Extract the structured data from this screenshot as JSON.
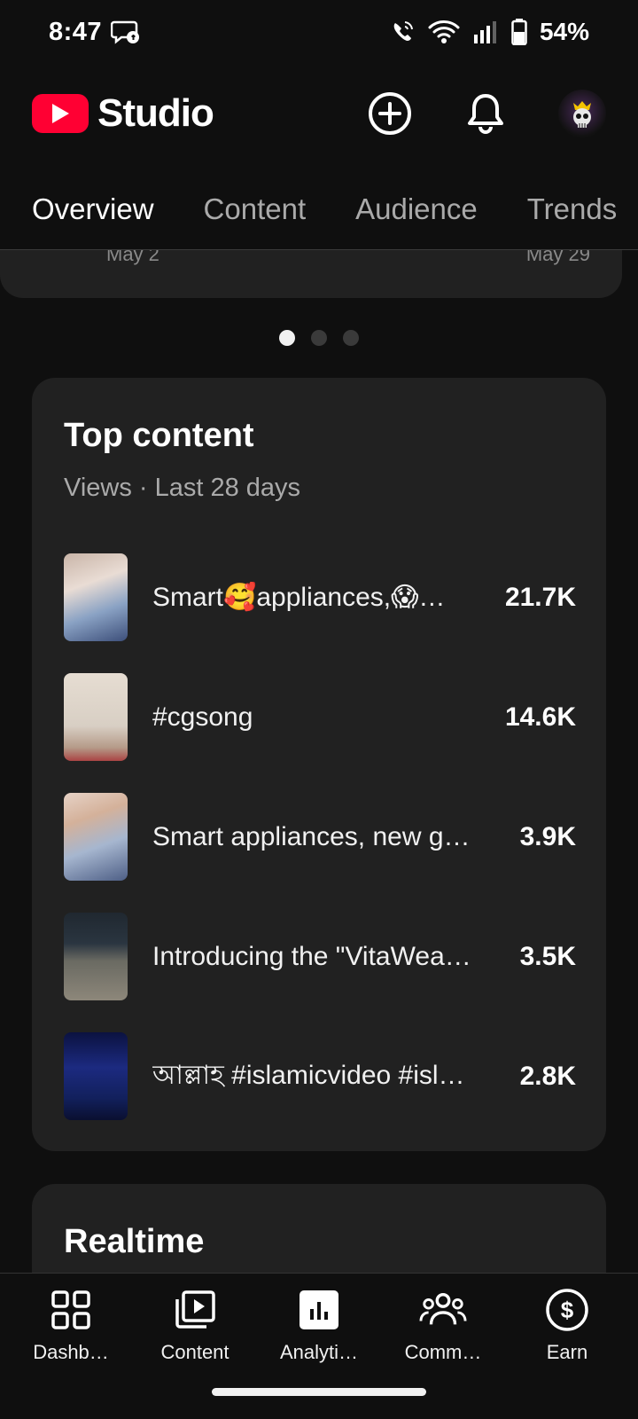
{
  "status_bar": {
    "time": "8:47",
    "battery": "54%"
  },
  "header": {
    "app_name": "Studio",
    "brand_color": "#ff0033"
  },
  "tabs": [
    {
      "label": "Overview",
      "active": true
    },
    {
      "label": "Content",
      "active": false
    },
    {
      "label": "Audience",
      "active": false
    },
    {
      "label": "Trends",
      "active": false
    }
  ],
  "chart_card": {
    "date_start": "May 2",
    "date_end": "May 29"
  },
  "carousel": {
    "page_count": 3,
    "active_index": 0
  },
  "top_content": {
    "title": "Top content",
    "subtitle": "Views · Last 28 days",
    "items": [
      {
        "title": "Smart🥰appliances,😱…",
        "views": "21.7K"
      },
      {
        "title": "#cgsong",
        "views": "14.6K"
      },
      {
        "title": "Smart appliances, new g…",
        "views": "3.9K"
      },
      {
        "title": "Introducing the \"VitaWea…",
        "views": "3.5K"
      },
      {
        "title": "আল্লাহ #islamicvideo #isl…",
        "views": "2.8K"
      }
    ]
  },
  "realtime": {
    "title": "Realtime"
  },
  "bottom_nav": [
    {
      "label": "Dashb…",
      "icon": "dashboard-icon"
    },
    {
      "label": "Content",
      "icon": "content-icon"
    },
    {
      "label": "Analyti…",
      "icon": "analytics-icon",
      "active": true
    },
    {
      "label": "Comm…",
      "icon": "community-icon"
    },
    {
      "label": "Earn",
      "icon": "earn-icon"
    }
  ]
}
